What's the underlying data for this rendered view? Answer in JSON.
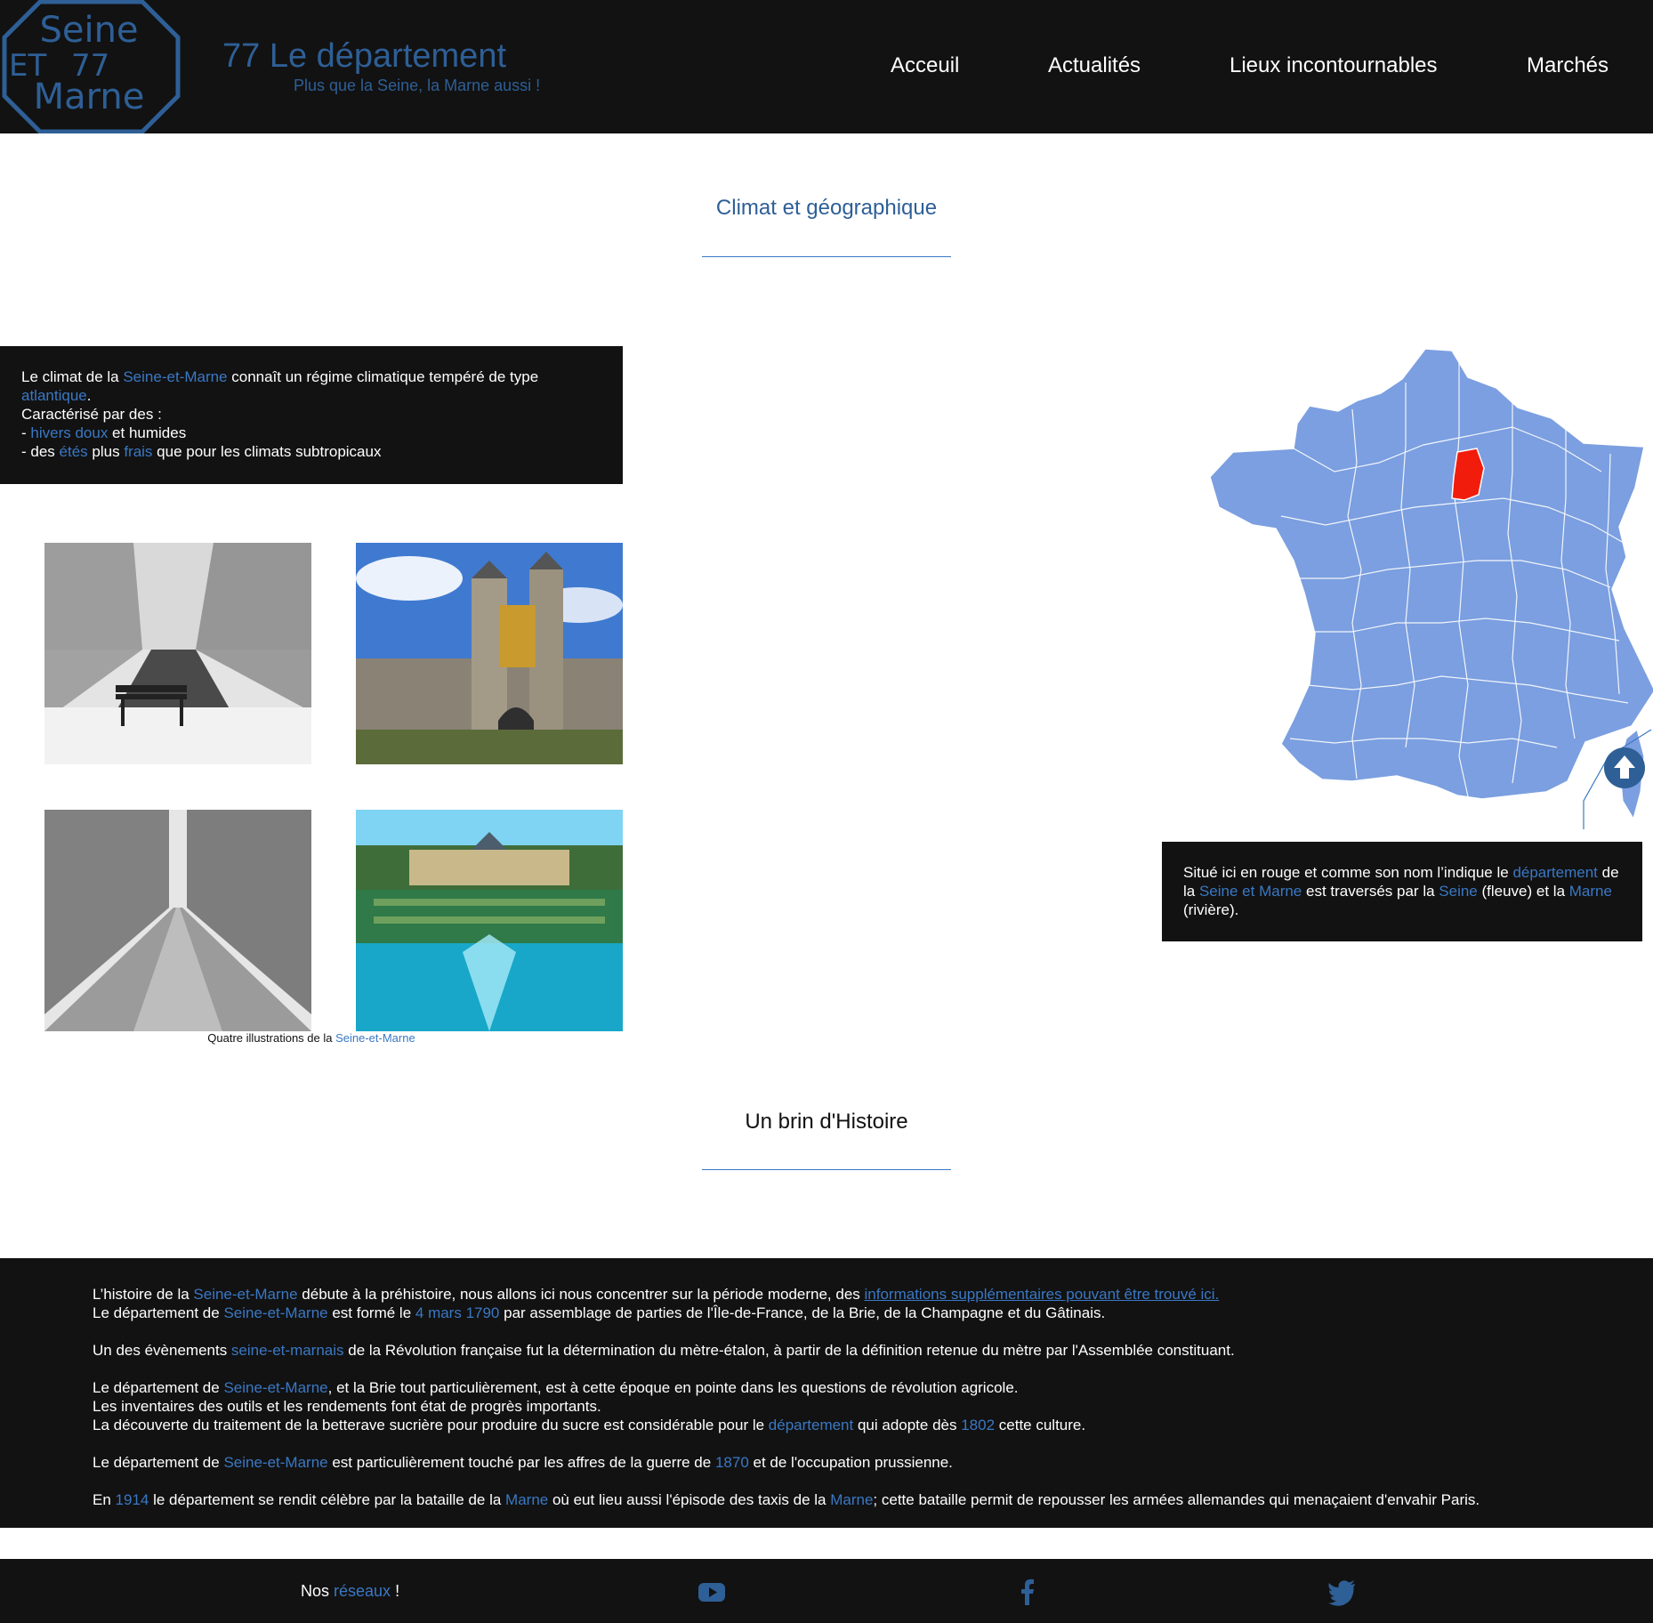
{
  "header": {
    "logo": {
      "line1": "Seine",
      "line2": "ET",
      "line3": "77",
      "line4": "Marne"
    },
    "title": "77 Le département",
    "subtitle": "Plus que la Seine, la Marne aussi !",
    "nav": [
      {
        "label": "Acceuil"
      },
      {
        "label": "Actualités"
      },
      {
        "label": "Lieux incontournables"
      },
      {
        "label": "Marchés"
      }
    ]
  },
  "climate_section": {
    "title": "Climat et géographique",
    "box": {
      "l1_a": "Le climat de la ",
      "l1_b": "Seine-et-Marne",
      "l1_c": " connaît un régime climatique tempéré de type ",
      "l1_d": "atlantique",
      "l1_e": ".",
      "l2": "Caractérisé par des :",
      "l3_a": "- ",
      "l3_b": "hivers doux",
      "l3_c": " et humides",
      "l4_a": "- des ",
      "l4_b": "étés",
      "l4_c": " plus ",
      "l4_d": "frais",
      "l4_e": " que pour les climats subtropicaux"
    },
    "caption_a": "Quatre illustrations de la ",
    "caption_b": "Seine-et-Marne",
    "map_box": {
      "a": "Situé ici en rouge et comme son nom l’indique le ",
      "b": "département",
      "c": " de la ",
      "d": "Seine et Marne",
      "e": " est traversés par la ",
      "f": "Seine",
      "g": " (fleuve) et la ",
      "h": "Marne",
      "i": " (rivière)."
    }
  },
  "history_section": {
    "title": "Un brin d'Histoire",
    "p1": {
      "a": "L’histoire de la ",
      "b": "Seine-et-Marne",
      "c": " débute à la préhistoire, nous allons ici nous concentrer sur la période moderne, des ",
      "link": "informations supplémentaires pouvant être trouvé ici.",
      "d": "Le département de ",
      "e": "Seine-et-Marne",
      "f": " est formé le ",
      "g": "4 mars 1790",
      "h": " par assemblage de parties de l'Île-de-France, de la Brie, de la Champagne et du Gâtinais."
    },
    "p2": {
      "a": "Un des évènements ",
      "b": "seine-et-marnais",
      "c": " de la Révolution française fut la détermination du mètre-étalon, à partir de la définition retenue du mètre par l'Assemblée constituant."
    },
    "p3": {
      "a": "Le département de ",
      "b": "Seine-et-Marne",
      "c": ", et la Brie tout particulièrement, est à cette époque en pointe dans les questions de révolution agricole.",
      "d": "Les inventaires des outils et les rendements font état de progrès importants.",
      "e": "La découverte du traitement de la betterave sucrière pour produire du sucre est considérable pour le ",
      "f": "département",
      "g": " qui adopte dès ",
      "h": "1802",
      "i": " cette culture."
    },
    "p4": {
      "a": "Le département de ",
      "b": "Seine-et-Marne",
      "c": " est particulièrement touché par les affres de la guerre de ",
      "d": "1870",
      "e": " et de l'occupation prussienne."
    },
    "p5": {
      "a": "En ",
      "b": "1914",
      "c": " le département se rendit célèbre par la bataille de la ",
      "d": "Marne",
      "e": " où eut lieu aussi l'épisode des taxis de la ",
      "f": "Marne",
      "g": "; cette bataille permit de repousser les armées allemandes qui menaçaient d'envahir Paris."
    }
  },
  "footer": {
    "a": "Nos ",
    "b": "réseaux",
    "c": " !",
    "icons": [
      "youtube-icon",
      "facebook-icon",
      "twitter-icon"
    ]
  },
  "colors": {
    "accent": "#3a78c4",
    "brand_dark": "#2e5f96",
    "background_dark": "#121212",
    "map_departments": "#7b9fe0",
    "map_highlight": "#f21c0c"
  }
}
